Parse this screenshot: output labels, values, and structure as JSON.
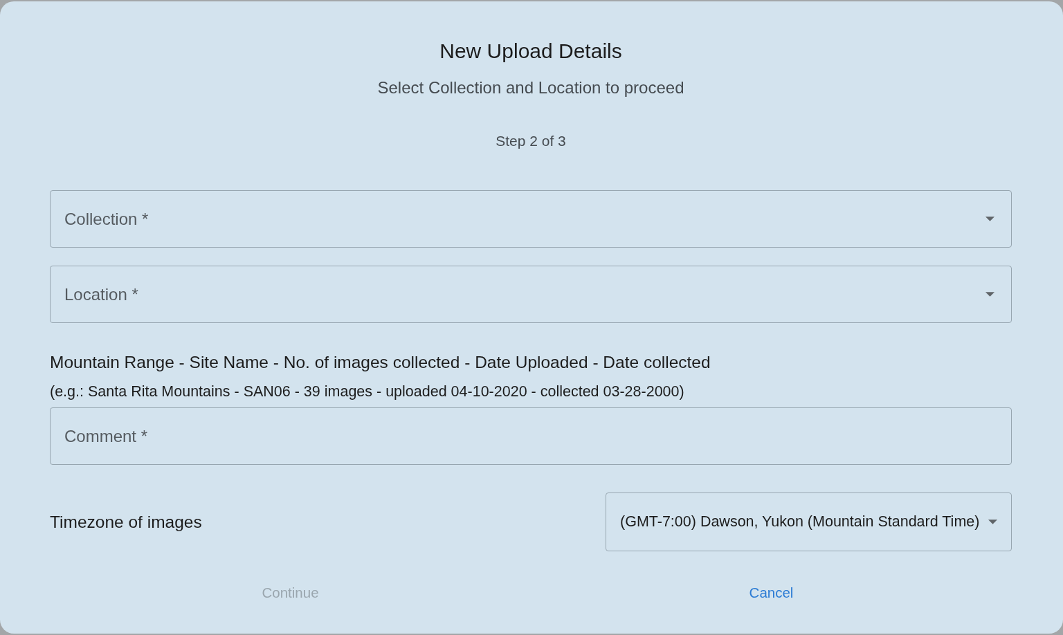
{
  "dialog": {
    "title": "New Upload Details",
    "subtitle": "Select Collection and Location to proceed",
    "step": "Step 2 of 3"
  },
  "selects": [
    {
      "label": "Collection *"
    },
    {
      "label": "Location *"
    }
  ],
  "format_hint": {
    "heading": "Mountain Range - Site Name - No. of images collected - Date Uploaded - Date collected",
    "example": "(e.g.: Santa Rita Mountains - SAN06 - 39 images - uploaded 04-10-2020 - collected 03-28-2000)"
  },
  "comment": {
    "placeholder": "Comment *"
  },
  "timezone": {
    "label": "Timezone of images",
    "value": "(GMT-7:00) Dawson, Yukon (Mountain Standard Time)"
  },
  "buttons": [
    {
      "label": "Continue",
      "disabled": true
    },
    {
      "label": "Cancel",
      "disabled": false
    }
  ]
}
